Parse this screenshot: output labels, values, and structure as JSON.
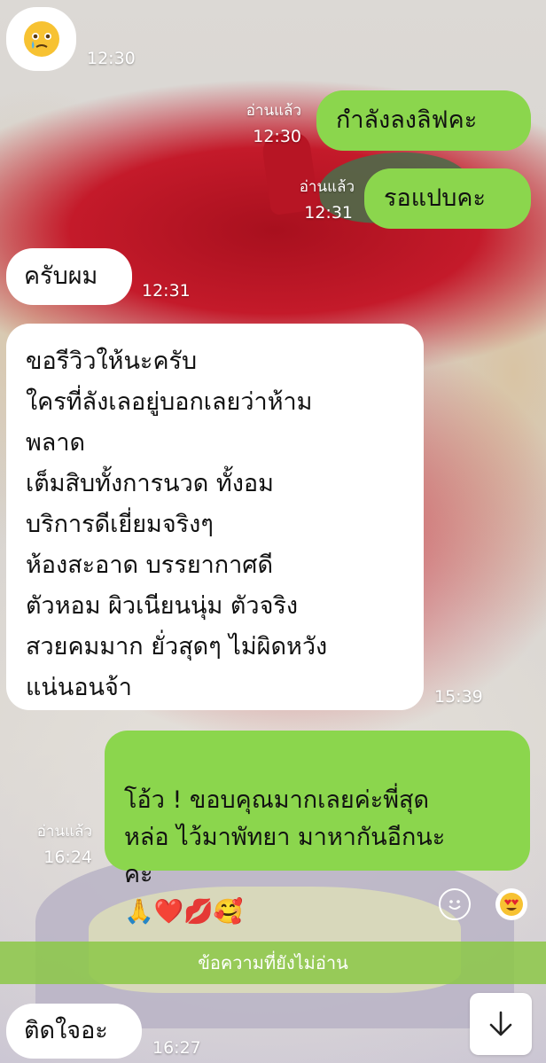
{
  "messages": [
    {
      "dir": "in",
      "kind": "emoji",
      "emoji_name": "face-holding-back-tears-icon",
      "time": "12:30"
    },
    {
      "dir": "out",
      "text": "กำลังลงลิฟคะ",
      "read": "อ่านแล้ว",
      "time": "12:30"
    },
    {
      "dir": "out",
      "text": "รอแปบคะ",
      "read": "อ่านแล้ว",
      "time": "12:31"
    },
    {
      "dir": "in",
      "text": "ครับผม",
      "time": "12:31"
    },
    {
      "dir": "in",
      "text": "ขอรีวิวให้นะครับ\nใครที่ลังเลอยู่บอกเลยว่าห้าม\nพลาด\nเต็มสิบทั้งการนวด ทั้งอม\nบริการดีเยี่ยมจริงๆ\nห้องสะอาด บรรยากาศดี\nตัวหอม ผิวเนียนนุ่ม ตัวจริง\nสวยคมมาก ยั่วสุดๆ ไม่ผิดหวัง\nแน่นอนจ้า",
      "time": "15:39"
    },
    {
      "dir": "out",
      "text": "โอ้ว ! ขอบคุณมากเลยค่ะพี่สุด\nหล่อ ไว้มาพัทยา มาหากันอีกนะ\nคะ",
      "emojis": [
        "🙏",
        "❤️",
        "💋",
        "🥰"
      ],
      "read": "อ่านแล้ว",
      "time": "16:24"
    },
    {
      "dir": "in",
      "text": "ติดใจอะ",
      "time": "16:27"
    }
  ],
  "reactions": {
    "add_icon": "smiley-outline-icon",
    "reaction_icon": "heart-eyes-icon"
  },
  "unread_bar": {
    "label": "ข้อความที่ยังไม่อ่าน"
  },
  "scroll_button": {
    "icon": "arrow-down-icon"
  },
  "colors": {
    "outgoing": "#8bd64d",
    "incoming": "#ffffff",
    "unread_bar": "#8cc846"
  }
}
